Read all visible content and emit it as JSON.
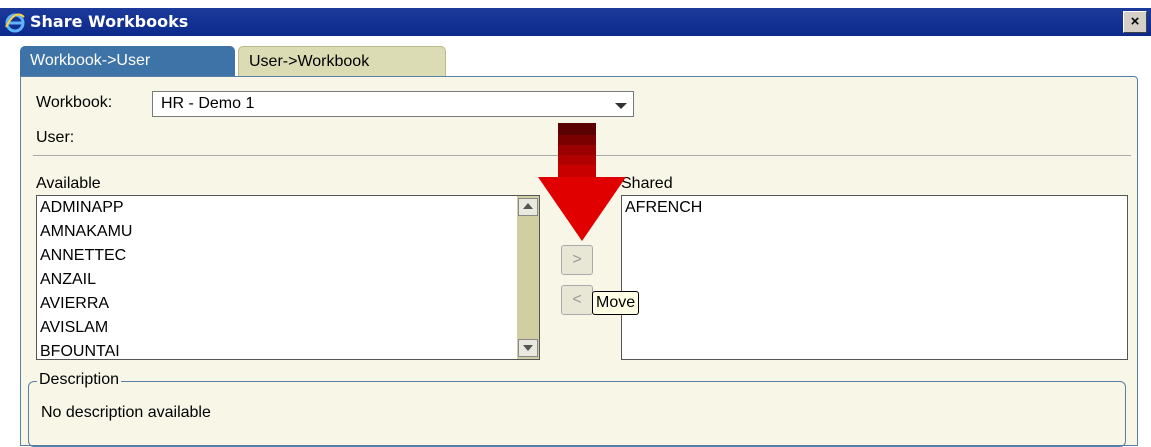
{
  "window": {
    "title": "Share Workbooks",
    "close_label": "×",
    "icon": "ie-icon"
  },
  "tabs": [
    {
      "label": "Workbook->User",
      "active": true
    },
    {
      "label": "User->Workbook",
      "active": false
    }
  ],
  "form": {
    "workbook_label": "Workbook:",
    "workbook_value": "HR - Demo 1",
    "user_label": "User:",
    "available_label": "Available",
    "shared_label": "Shared"
  },
  "available_items": [
    "ADMINAPP",
    "AMNAKAMU",
    "ANNETTEC",
    "ANZAIL",
    "AVIERRA",
    "AVISLAM",
    "BFOUNTAI"
  ],
  "shared_items": [
    "AFRENCH"
  ],
  "move_buttons": {
    "move_right": ">",
    "move_left": "<"
  },
  "tooltip": "Move",
  "description": {
    "legend": "Description",
    "text": "No description available"
  },
  "colors": {
    "tab_active": "#3d73a6",
    "tab_inactive": "#dcdcb4",
    "panel_bg": "#f7f6e7",
    "annotation_arrow": "#cc0000"
  }
}
